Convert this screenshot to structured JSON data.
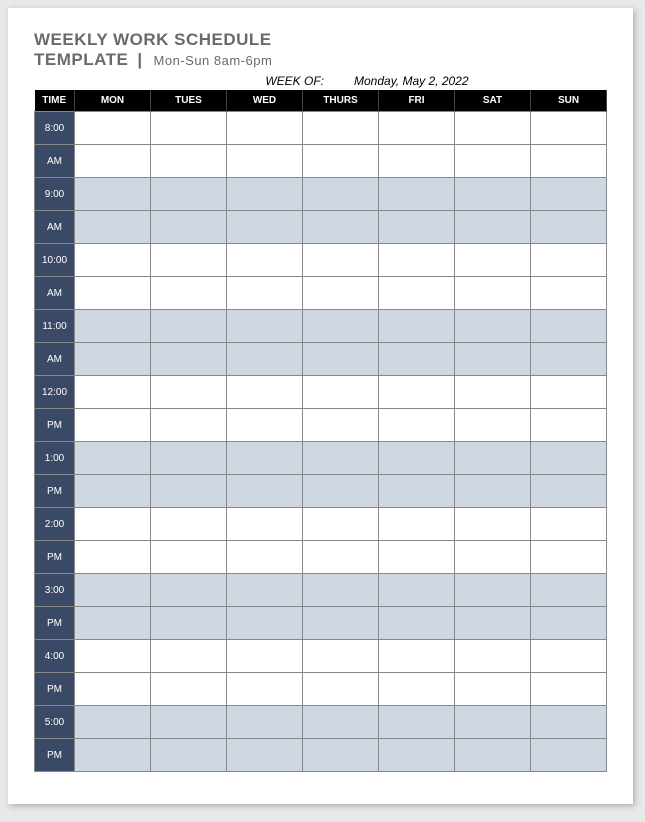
{
  "header": {
    "title_line1": "WEEKLY WORK SCHEDULE",
    "title_line2": "TEMPLATE",
    "subtitle": "Mon-Sun 8am-6pm",
    "week_of_label": "WEEK OF:",
    "week_of_value": "Monday, May 2, 2022"
  },
  "columns": {
    "time": "TIME",
    "days": [
      "MON",
      "TUES",
      "WED",
      "THURS",
      "FRI",
      "SAT",
      "SUN"
    ]
  },
  "rows": [
    {
      "time": "8:00",
      "shaded": false
    },
    {
      "time": "AM",
      "shaded": false
    },
    {
      "time": "9:00",
      "shaded": true
    },
    {
      "time": "AM",
      "shaded": true
    },
    {
      "time": "10:00",
      "shaded": false
    },
    {
      "time": "AM",
      "shaded": false
    },
    {
      "time": "11:00",
      "shaded": true
    },
    {
      "time": "AM",
      "shaded": true
    },
    {
      "time": "12:00",
      "shaded": false
    },
    {
      "time": "PM",
      "shaded": false
    },
    {
      "time": "1:00",
      "shaded": true
    },
    {
      "time": "PM",
      "shaded": true
    },
    {
      "time": "2:00",
      "shaded": false
    },
    {
      "time": "PM",
      "shaded": false
    },
    {
      "time": "3:00",
      "shaded": true
    },
    {
      "time": "PM",
      "shaded": true
    },
    {
      "time": "4:00",
      "shaded": false
    },
    {
      "time": "PM",
      "shaded": false
    },
    {
      "time": "5:00",
      "shaded": true
    },
    {
      "time": "PM",
      "shaded": true
    }
  ]
}
